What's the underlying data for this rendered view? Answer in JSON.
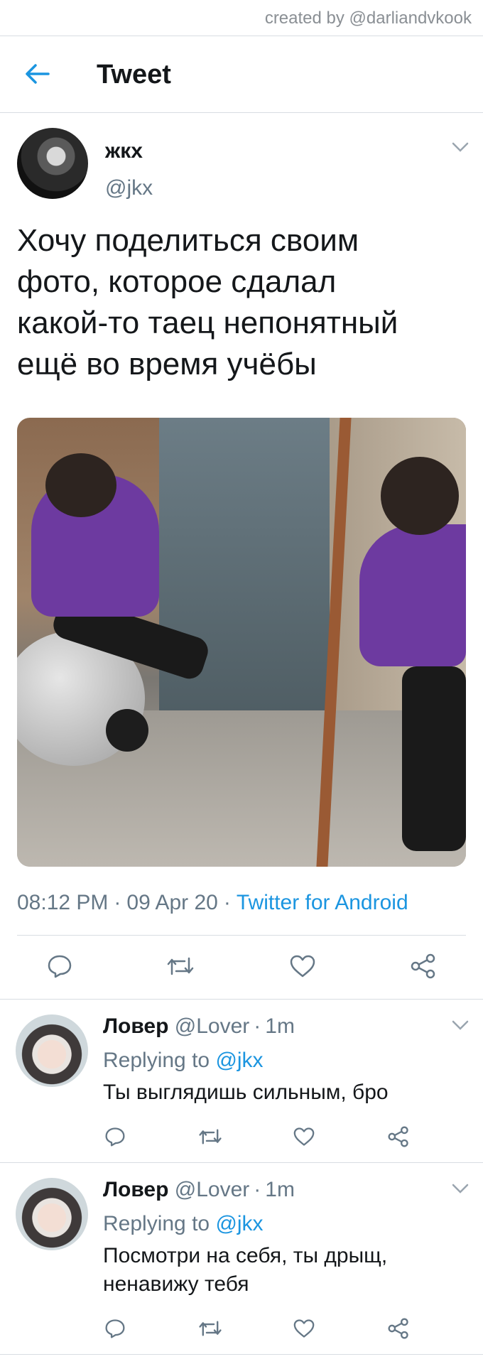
{
  "watermark": "created by @darliandvkook",
  "header": {
    "title": "Tweet"
  },
  "tweet": {
    "author_name": "жкх",
    "author_handle": "@jkx",
    "text_lines": [
      "Хочу поделиться своим",
      "фото, которое сдалал",
      "какой-то таец непонятный",
      "ещё во время учёбы"
    ],
    "time": "08:12 PM",
    "date": "09 Apr 20",
    "source": "Twitter for Android",
    "separator": "·"
  },
  "actions": [
    "reply-icon",
    "retweet-icon",
    "like-icon",
    "share-icon"
  ],
  "replies": [
    {
      "name": "Ловер",
      "handle": "@Lover",
      "time": "1m",
      "replying_label": "Replying to",
      "replying_to": "@jkx",
      "text_lines": [
        "Ты выглядишь сильным, бро"
      ]
    },
    {
      "name": "Ловер",
      "handle": "@Lover",
      "time": "1m",
      "replying_label": "Replying to",
      "replying_to": "@jkx",
      "text_lines": [
        "Посмотри на себя, ты дрыщ,",
        "ненавижу тебя"
      ]
    }
  ],
  "colors": {
    "accent": "#1b95e0",
    "muted": "#657786",
    "text": "#14171a",
    "border": "#d8dde2"
  }
}
